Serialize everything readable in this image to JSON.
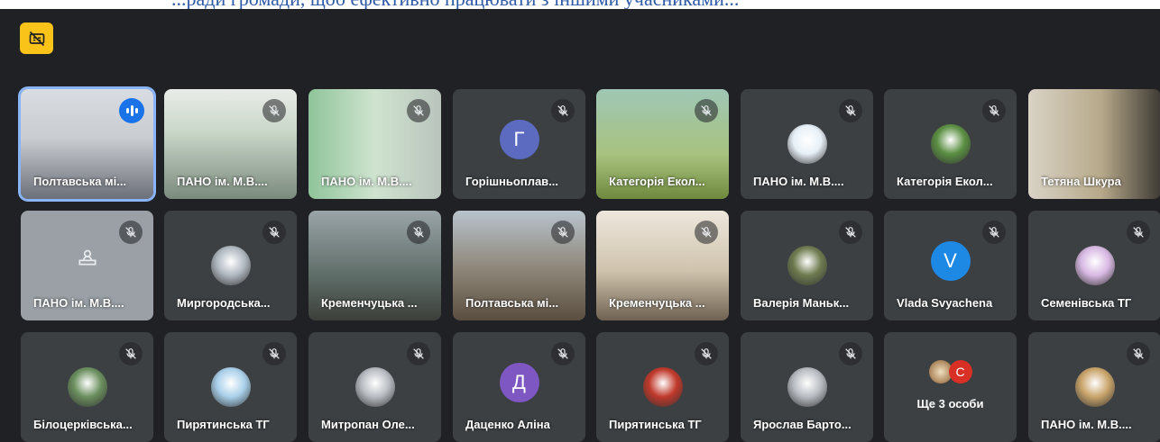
{
  "header": {
    "partial_text": "...ради громади, щоб ефективно працювати з іншими учасниками..."
  },
  "controls": {
    "captions_icon": "captions-off-icon",
    "accent": "#f9c319"
  },
  "colors": {
    "background": "#202124",
    "tile": "#3c4043",
    "active_border": "#8ab4f8",
    "speaking": "#1a73e8"
  },
  "tiles": [
    {
      "name": "Полтавська мі...",
      "type": "video",
      "speaking": true
    },
    {
      "name": "ПАНО ім. М.В....",
      "type": "video",
      "muted": true
    },
    {
      "name": "ПАНО ім. М.В....",
      "type": "video",
      "muted": true
    },
    {
      "name": "Горішньоплав...",
      "type": "letter",
      "letter": "Г",
      "color": "#5c6bc0",
      "muted": true
    },
    {
      "name": "Категорія Екол...",
      "type": "video",
      "muted": true
    },
    {
      "name": "ПАНО ім. М.В....",
      "type": "avatar",
      "muted": true
    },
    {
      "name": "Категорія Екол...",
      "type": "avatar",
      "muted": true
    },
    {
      "name": "Тетяна Шкура",
      "type": "video"
    },
    {
      "name": "ПАНО ім. М.В....",
      "type": "presence",
      "muted": true
    },
    {
      "name": "Миргородська...",
      "type": "avatar",
      "muted": true
    },
    {
      "name": "Кременчуцька ...",
      "type": "video",
      "muted": true
    },
    {
      "name": "Полтавська мі...",
      "type": "video",
      "muted": true
    },
    {
      "name": "Кременчуцька ...",
      "type": "video",
      "muted": true
    },
    {
      "name": "Валерія Маньк...",
      "type": "avatar",
      "muted": true
    },
    {
      "name": "Vlada Svyachena",
      "type": "letter",
      "letter": "V",
      "color": "#1e88e5",
      "muted": true
    },
    {
      "name": "Семенівська ТГ",
      "type": "avatar",
      "muted": true
    },
    {
      "name": "Білоцерківська...",
      "type": "avatar",
      "muted": true
    },
    {
      "name": "Пирятинська ТГ",
      "type": "avatar",
      "muted": true
    },
    {
      "name": "Митропан Оле...",
      "type": "avatar",
      "muted": true
    },
    {
      "name": "Даценко Аліна",
      "type": "letter",
      "letter": "Д",
      "color": "#7e57c2",
      "muted": true
    },
    {
      "name": "Пирятинська ТГ",
      "type": "avatar",
      "muted": true
    },
    {
      "name": "Ярослав Барто...",
      "type": "avatar",
      "muted": true
    },
    {
      "name": "Ще 3 особи",
      "type": "more",
      "letter": "С"
    },
    {
      "name": "ПАНО ім. М.В....",
      "type": "avatar",
      "muted": true
    }
  ]
}
